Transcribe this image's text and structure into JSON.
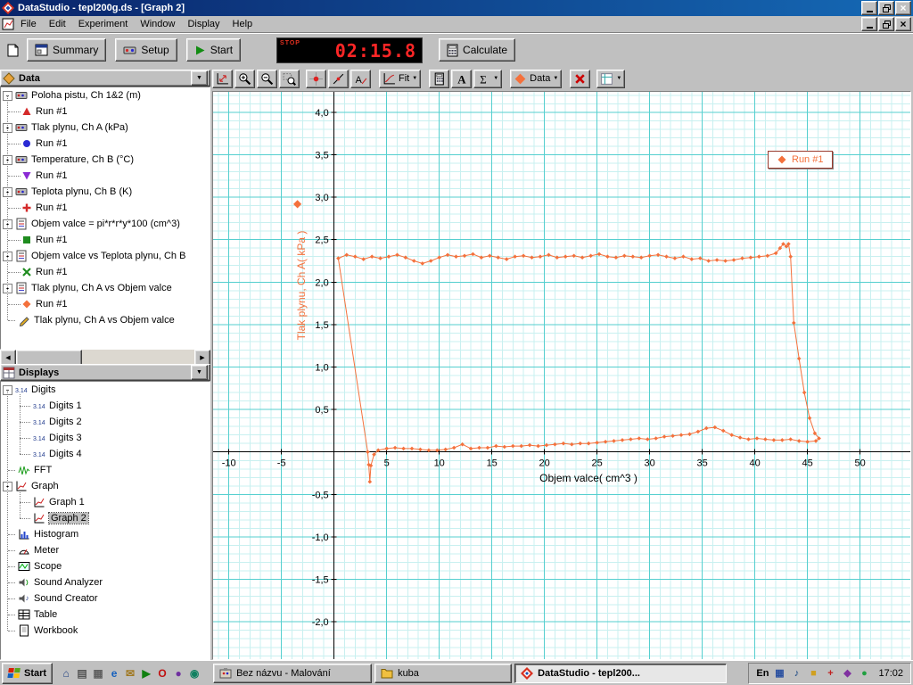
{
  "window": {
    "title": "DataStudio - tepl200g.ds - [Graph 2]"
  },
  "menu": {
    "items": [
      "File",
      "Edit",
      "Experiment",
      "Window",
      "Display",
      "Help"
    ]
  },
  "toolbar": {
    "summary_label": "Summary",
    "setup_label": "Setup",
    "start_label": "Start",
    "stop_label": "STOP",
    "timer_value": "02:15.8",
    "calculate_label": "Calculate"
  },
  "graph_toolbar": {
    "buttons": [
      {
        "name": "scale-to-fit-button",
        "icon": "scale-to-fit"
      },
      {
        "name": "zoom-in-button",
        "icon": "zoom-in"
      },
      {
        "name": "zoom-out-button",
        "icon": "zoom-out"
      },
      {
        "name": "zoom-select-button",
        "icon": "zoom-select"
      },
      {
        "name": "smart-tool-button",
        "icon": "smart-tool"
      },
      {
        "name": "slope-tool-button",
        "icon": "slope-tool"
      },
      {
        "name": "note-tool-button",
        "icon": "note-tool"
      },
      {
        "name": "fit-menu-button",
        "icon": "fit-chart",
        "label": "Fit",
        "dropdown": true
      },
      {
        "name": "calculator-button",
        "icon": "calculator"
      },
      {
        "name": "text-button",
        "icon": "text"
      },
      {
        "name": "statistics-button",
        "icon": "sigma",
        "dropdown": true
      },
      {
        "name": "data-menu-button",
        "icon": "data-diamond",
        "label": "Data",
        "dropdown": true
      },
      {
        "name": "remove-button",
        "icon": "delete-x"
      },
      {
        "name": "settings-button",
        "icon": "graph-settings",
        "dropdown": true
      }
    ]
  },
  "sidebar": {
    "data_panel": {
      "title": "Data",
      "items": [
        {
          "label": "Poloha pistu, Ch 1&2 (m)",
          "icon": "sensor",
          "runs": [
            {
              "label": "Run #1",
              "marker": "triangle-up",
              "color": "#d42a2a"
            }
          ]
        },
        {
          "label": "Tlak plynu, Ch A (kPa)",
          "icon": "sensor",
          "runs": [
            {
              "label": "Run #1",
              "marker": "circle",
              "color": "#2a2ad4"
            }
          ]
        },
        {
          "label": "Temperature, Ch B (°C)",
          "icon": "sensor",
          "runs": [
            {
              "label": "Run #1",
              "marker": "triangle-down",
              "color": "#8a2ad4"
            }
          ]
        },
        {
          "label": "Teplota plynu, Ch B (K)",
          "icon": "sensor",
          "runs": [
            {
              "label": "Run #1",
              "marker": "plus",
              "color": "#d42a2a"
            }
          ]
        },
        {
          "label": "Objem valce = pi*r*r*y*100 (cm^3)",
          "icon": "calc",
          "runs": [
            {
              "label": "Run #1",
              "marker": "square",
              "color": "#1f8c1f"
            }
          ]
        },
        {
          "label": "Objem valce vs Teplota plynu, Ch B",
          "icon": "calc",
          "runs": [
            {
              "label": "Run #1",
              "marker": "x",
              "color": "#1f8c1f"
            }
          ]
        },
        {
          "label": "Tlak plynu, Ch A vs Objem valce",
          "icon": "calc",
          "runs": [
            {
              "label": "Run #1",
              "marker": "diamond",
              "color": "#f4713c"
            }
          ]
        },
        {
          "label": "Tlak plynu, Ch A vs Objem valce",
          "icon": "pencil",
          "runs": []
        }
      ]
    },
    "displays_panel": {
      "title": "Displays",
      "items": [
        {
          "label": "Digits",
          "icon": "digits",
          "children": [
            {
              "label": "Digits 1",
              "icon": "digits"
            },
            {
              "label": "Digits 2",
              "icon": "digits"
            },
            {
              "label": "Digits 3",
              "icon": "digits"
            },
            {
              "label": "Digits 4",
              "icon": "digits"
            }
          ]
        },
        {
          "label": "FFT",
          "icon": "fft"
        },
        {
          "label": "Graph",
          "icon": "graph",
          "children": [
            {
              "label": "Graph 1",
              "icon": "graph"
            },
            {
              "label": "Graph 2",
              "icon": "graph",
              "selected": true
            }
          ]
        },
        {
          "label": "Histogram",
          "icon": "histogram"
        },
        {
          "label": "Meter",
          "icon": "meter"
        },
        {
          "label": "Scope",
          "icon": "scope"
        },
        {
          "label": "Sound Analyzer",
          "icon": "sound-analyzer"
        },
        {
          "label": "Sound Creator",
          "icon": "sound-creator"
        },
        {
          "label": "Table",
          "icon": "table"
        },
        {
          "label": "Workbook",
          "icon": "workbook"
        }
      ]
    }
  },
  "chart_data": {
    "type": "line",
    "title": "",
    "xlabel": "Objem valce( cm^3 )",
    "ylabel": "Tlak plynu, Ch A( kPa )",
    "xlim": [
      -11.5,
      54.95
    ],
    "ylim": [
      -2.46,
      4.24
    ],
    "x_minor_step": 1,
    "x_major_step": 5,
    "y_minor_step": 0.1,
    "y_major_step": 0.5,
    "grid": true,
    "legend": {
      "label": "Run #1",
      "position": "top-right"
    },
    "x_ticks": [
      {
        "v": -10,
        "label": "-10"
      },
      {
        "v": -5,
        "label": "-5"
      },
      {
        "v": 5,
        "label": "5"
      },
      {
        "v": 10,
        "label": "10"
      },
      {
        "v": 15,
        "label": "15"
      },
      {
        "v": 20,
        "label": "20"
      },
      {
        "v": 25,
        "label": "25"
      },
      {
        "v": 30,
        "label": "30"
      },
      {
        "v": 35,
        "label": "35"
      },
      {
        "v": 40,
        "label": "40"
      },
      {
        "v": 45,
        "label": "45"
      },
      {
        "v": 50,
        "label": "50"
      }
    ],
    "y_ticks": [
      {
        "v": 4,
        "label": "4,0"
      },
      {
        "v": 3.5,
        "label": "3,5"
      },
      {
        "v": 3,
        "label": "3,0"
      },
      {
        "v": 2.5,
        "label": "2,5"
      },
      {
        "v": 2,
        "label": "2,0"
      },
      {
        "v": 1.5,
        "label": "1,5"
      },
      {
        "v": 1,
        "label": "1,0"
      },
      {
        "v": 0.5,
        "label": "0,5"
      },
      {
        "v": -0.5,
        "label": "-0,5"
      },
      {
        "v": -1,
        "label": "-1,0"
      },
      {
        "v": -1.5,
        "label": "-1,5"
      },
      {
        "v": -2,
        "label": "-2,0"
      }
    ],
    "series": [
      {
        "name": "Run #1",
        "marker": "diamond",
        "color": "#f4713c",
        "points": [
          [
            0.4,
            2.28
          ],
          [
            1.2,
            2.32
          ],
          [
            2.0,
            2.3
          ],
          [
            2.8,
            2.27
          ],
          [
            3.6,
            2.3
          ],
          [
            4.4,
            2.28
          ],
          [
            5.2,
            2.3
          ],
          [
            6.0,
            2.32
          ],
          [
            6.8,
            2.29
          ],
          [
            7.6,
            2.25
          ],
          [
            8.4,
            2.22
          ],
          [
            9.2,
            2.25
          ],
          [
            10.0,
            2.29
          ],
          [
            10.8,
            2.32
          ],
          [
            11.6,
            2.3
          ],
          [
            12.4,
            2.31
          ],
          [
            13.2,
            2.33
          ],
          [
            14.0,
            2.29
          ],
          [
            14.8,
            2.31
          ],
          [
            15.6,
            2.29
          ],
          [
            16.4,
            2.27
          ],
          [
            17.2,
            2.3
          ],
          [
            18.0,
            2.31
          ],
          [
            18.8,
            2.29
          ],
          [
            19.6,
            2.3
          ],
          [
            20.4,
            2.32
          ],
          [
            21.2,
            2.29
          ],
          [
            22.0,
            2.3
          ],
          [
            22.8,
            2.31
          ],
          [
            23.6,
            2.29
          ],
          [
            24.4,
            2.31
          ],
          [
            25.2,
            2.33
          ],
          [
            26.0,
            2.3
          ],
          [
            26.8,
            2.29
          ],
          [
            27.6,
            2.31
          ],
          [
            28.4,
            2.3
          ],
          [
            29.2,
            2.29
          ],
          [
            30.0,
            2.31
          ],
          [
            30.8,
            2.32
          ],
          [
            31.6,
            2.3
          ],
          [
            32.4,
            2.28
          ],
          [
            33.2,
            2.3
          ],
          [
            34.0,
            2.27
          ],
          [
            34.8,
            2.28
          ],
          [
            35.6,
            2.25
          ],
          [
            36.4,
            2.26
          ],
          [
            37.2,
            2.25
          ],
          [
            38.0,
            2.26
          ],
          [
            38.8,
            2.28
          ],
          [
            39.6,
            2.29
          ],
          [
            40.4,
            2.3
          ],
          [
            41.2,
            2.31
          ],
          [
            42.0,
            2.34
          ],
          [
            42.4,
            2.4
          ],
          [
            42.7,
            2.45
          ],
          [
            43.0,
            2.42
          ],
          [
            43.2,
            2.45
          ],
          [
            43.4,
            2.3
          ],
          [
            43.7,
            1.52
          ],
          [
            44.2,
            1.1
          ],
          [
            44.7,
            0.7
          ],
          [
            45.2,
            0.4
          ],
          [
            45.7,
            0.22
          ],
          [
            46.1,
            0.16
          ],
          [
            45.8,
            0.13
          ],
          [
            45.0,
            0.12
          ],
          [
            44.2,
            0.13
          ],
          [
            43.4,
            0.15
          ],
          [
            42.6,
            0.14
          ],
          [
            41.8,
            0.14
          ],
          [
            41.0,
            0.15
          ],
          [
            40.2,
            0.16
          ],
          [
            39.4,
            0.15
          ],
          [
            38.6,
            0.17
          ],
          [
            37.8,
            0.2
          ],
          [
            37.0,
            0.25
          ],
          [
            36.2,
            0.29
          ],
          [
            35.4,
            0.28
          ],
          [
            34.6,
            0.24
          ],
          [
            33.8,
            0.21
          ],
          [
            33.0,
            0.2
          ],
          [
            32.2,
            0.19
          ],
          [
            31.4,
            0.18
          ],
          [
            30.6,
            0.16
          ],
          [
            29.8,
            0.15
          ],
          [
            29.0,
            0.16
          ],
          [
            28.2,
            0.15
          ],
          [
            27.4,
            0.14
          ],
          [
            26.6,
            0.13
          ],
          [
            25.8,
            0.12
          ],
          [
            25.0,
            0.11
          ],
          [
            24.2,
            0.1
          ],
          [
            23.4,
            0.1
          ],
          [
            22.6,
            0.09
          ],
          [
            21.8,
            0.1
          ],
          [
            21.0,
            0.09
          ],
          [
            20.2,
            0.08
          ],
          [
            19.4,
            0.07
          ],
          [
            18.6,
            0.08
          ],
          [
            17.8,
            0.07
          ],
          [
            17.0,
            0.07
          ],
          [
            16.2,
            0.06
          ],
          [
            15.4,
            0.07
          ],
          [
            14.6,
            0.05
          ],
          [
            13.8,
            0.05
          ],
          [
            13.0,
            0.04
          ],
          [
            12.2,
            0.09
          ],
          [
            11.4,
            0.05
          ],
          [
            10.6,
            0.03
          ],
          [
            9.8,
            0.02
          ],
          [
            9.0,
            0.02
          ],
          [
            8.2,
            0.03
          ],
          [
            7.4,
            0.04
          ],
          [
            6.6,
            0.04
          ],
          [
            5.8,
            0.05
          ],
          [
            5.0,
            0.04
          ],
          [
            4.2,
            0.02
          ],
          [
            3.8,
            -0.03
          ],
          [
            3.5,
            -0.16
          ],
          [
            3.4,
            -0.35
          ],
          [
            3.3,
            -0.15
          ],
          [
            3.2,
            0.0
          ],
          [
            0.4,
            2.28
          ]
        ]
      }
    ]
  },
  "taskbar": {
    "start_label": "Start",
    "quick_launch": [
      "desktop-icon",
      "document-icon",
      "printer-icon",
      "internet-icon",
      "mail-icon",
      "media-icon",
      "browser-icon",
      "player-icon",
      "messenger-icon"
    ],
    "tasks": [
      {
        "label": "Bez názvu - Malování",
        "icon": "paint",
        "active": false
      },
      {
        "label": "kuba",
        "icon": "folder",
        "active": false
      },
      {
        "label": "DataStudio - tepl200...",
        "icon": "datastudio",
        "active": true
      }
    ],
    "tray": {
      "language": "En",
      "icons": [
        "keyboard-icon",
        "volume-icon",
        "scheduler-icon",
        "antivirus-icon",
        "graphics-icon",
        "network-icon"
      ],
      "clock": "17:02"
    }
  },
  "colors": {
    "accent": "#f4713c",
    "series": "#f4713c",
    "grid_minor": "#c9f0f0",
    "grid_major": "#55cfcf",
    "timer_digits": "#ff2626",
    "titlebar": "#0a246a"
  }
}
